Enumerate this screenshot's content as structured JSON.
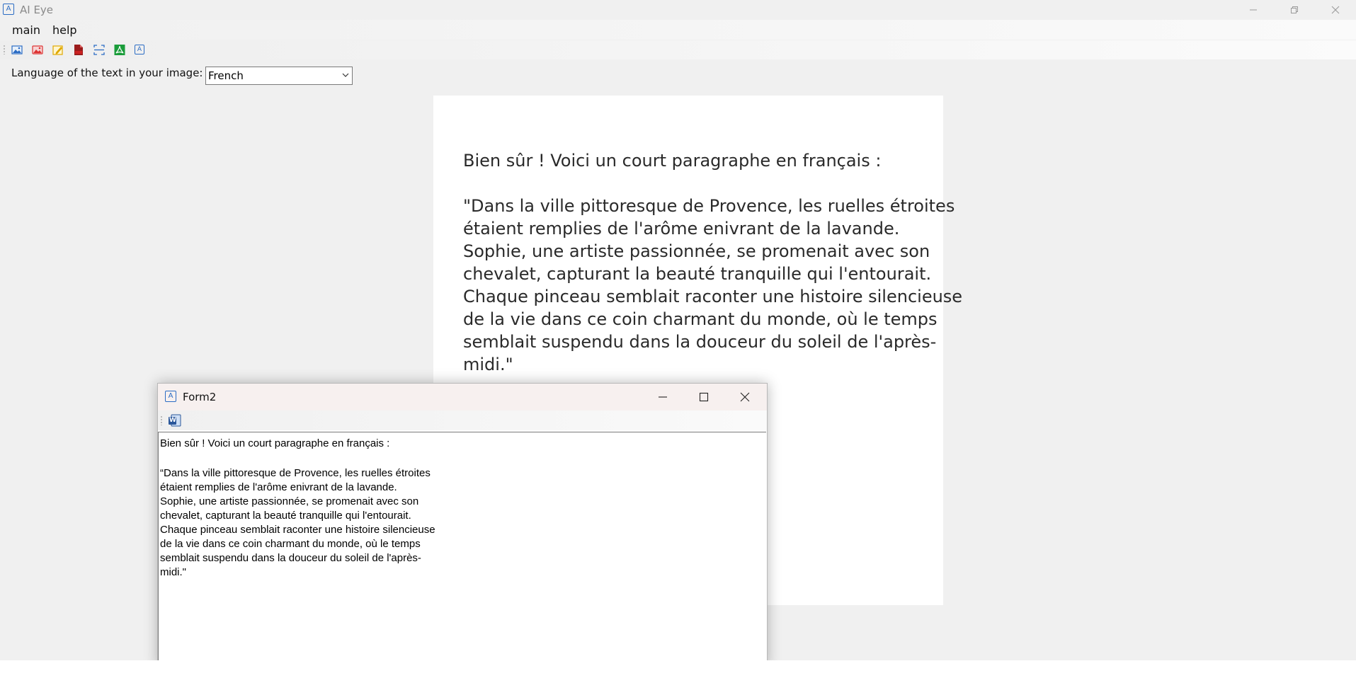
{
  "window": {
    "title": "AI Eye",
    "icon_glyph": "A"
  },
  "menu": {
    "items": [
      "main",
      "help"
    ]
  },
  "toolbar": {
    "buttons": [
      {
        "icon": "open-image-icon"
      },
      {
        "icon": "image-alt-icon"
      },
      {
        "icon": "edit-image-icon"
      },
      {
        "icon": "pdf-icon"
      },
      {
        "icon": "scan-icon"
      },
      {
        "icon": "acrobat-icon"
      },
      {
        "icon": "ocr-text-icon"
      }
    ]
  },
  "language": {
    "label": "Language of the text in your image:",
    "selected": "French"
  },
  "image": {
    "heading": "Bien sûr ! Voici un court paragraphe en français :",
    "paragraph": "\"Dans la ville pittoresque de Provence, les ruelles étroites\nétaient remplies de l'arôme enivrant de la lavande.\nSophie, une artiste passionnée, se promenait avec son\nchevalet, capturant la beauté tranquille qui l'entourait.\nChaque pinceau semblait raconter une histoire silencieuse\nde la vie dans ce coin charmant du monde, où le temps\nsemblait suspendu dans la douceur du soleil de l'après-\nmidi.\""
  },
  "form2": {
    "title": "Form2",
    "icon_glyph": "A",
    "word_icon_glyph": "W",
    "textbox": {
      "heading": "Bien sûr ! Voici un court paragraphe en français :",
      "paragraph": "“Dans la ville pittoresque de Provence, les ruelles étroites\nétaient remplies de l'arôme enivrant de la lavande.\nSophie, une artiste passionnée, se promenait avec son\nchevalet, capturant la beauté tranquille qui l'entourait.\nChaque pinceau semblait raconter une histoire silencieuse\nde la vie dans ce coin charmant du monde, où le temps\nsemblait suspendu dans la douceur du soleil de l'après-\nmidi.\""
    }
  },
  "colors": {
    "accent": "#2b6cc4",
    "background": "#f0f0f0",
    "dialog_titlebar": "#f7f0ef"
  }
}
